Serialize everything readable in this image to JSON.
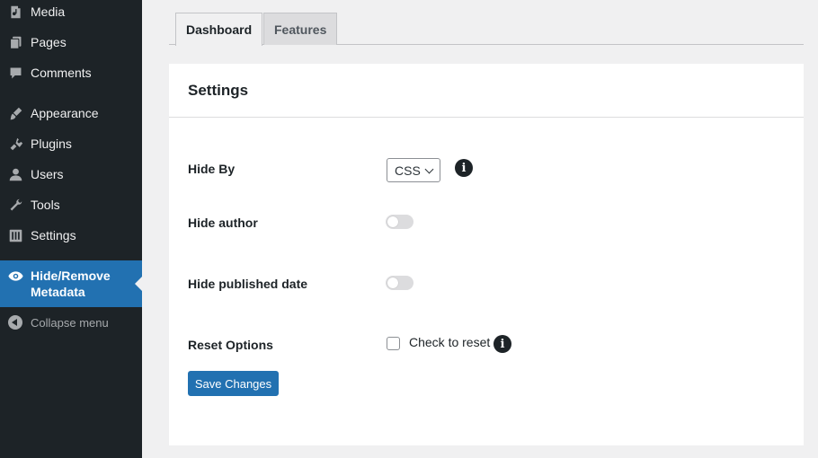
{
  "sidebar": {
    "items": [
      {
        "label": "Media",
        "icon": "media-icon"
      },
      {
        "label": "Pages",
        "icon": "pages-icon"
      },
      {
        "label": "Comments",
        "icon": "comments-icon"
      },
      {
        "label": "Appearance",
        "icon": "appearance-icon"
      },
      {
        "label": "Plugins",
        "icon": "plugins-icon"
      },
      {
        "label": "Users",
        "icon": "users-icon"
      },
      {
        "label": "Tools",
        "icon": "tools-icon"
      },
      {
        "label": "Settings",
        "icon": "settings-icon"
      },
      {
        "label": "Hide/Remove Metadata",
        "icon": "eye-icon",
        "current": true
      },
      {
        "label": "Collapse menu",
        "icon": "collapse-icon"
      }
    ]
  },
  "tabs": [
    {
      "label": "Dashboard",
      "active": true
    },
    {
      "label": "Features",
      "active": false
    }
  ],
  "panel": {
    "title": "Settings",
    "hide_by": {
      "label": "Hide By",
      "value": "CSS"
    },
    "hide_author": {
      "label": "Hide author",
      "enabled": false
    },
    "hide_published_date": {
      "label": "Hide published date",
      "enabled": false
    },
    "reset_options": {
      "label": "Reset Options",
      "checkbox_label": "Check to reset",
      "checked": false
    },
    "save_button": "Save Changes"
  },
  "colors": {
    "sidebar_bg": "#1d2327",
    "accent": "#2271b1",
    "page_bg": "#f0f0f1"
  }
}
